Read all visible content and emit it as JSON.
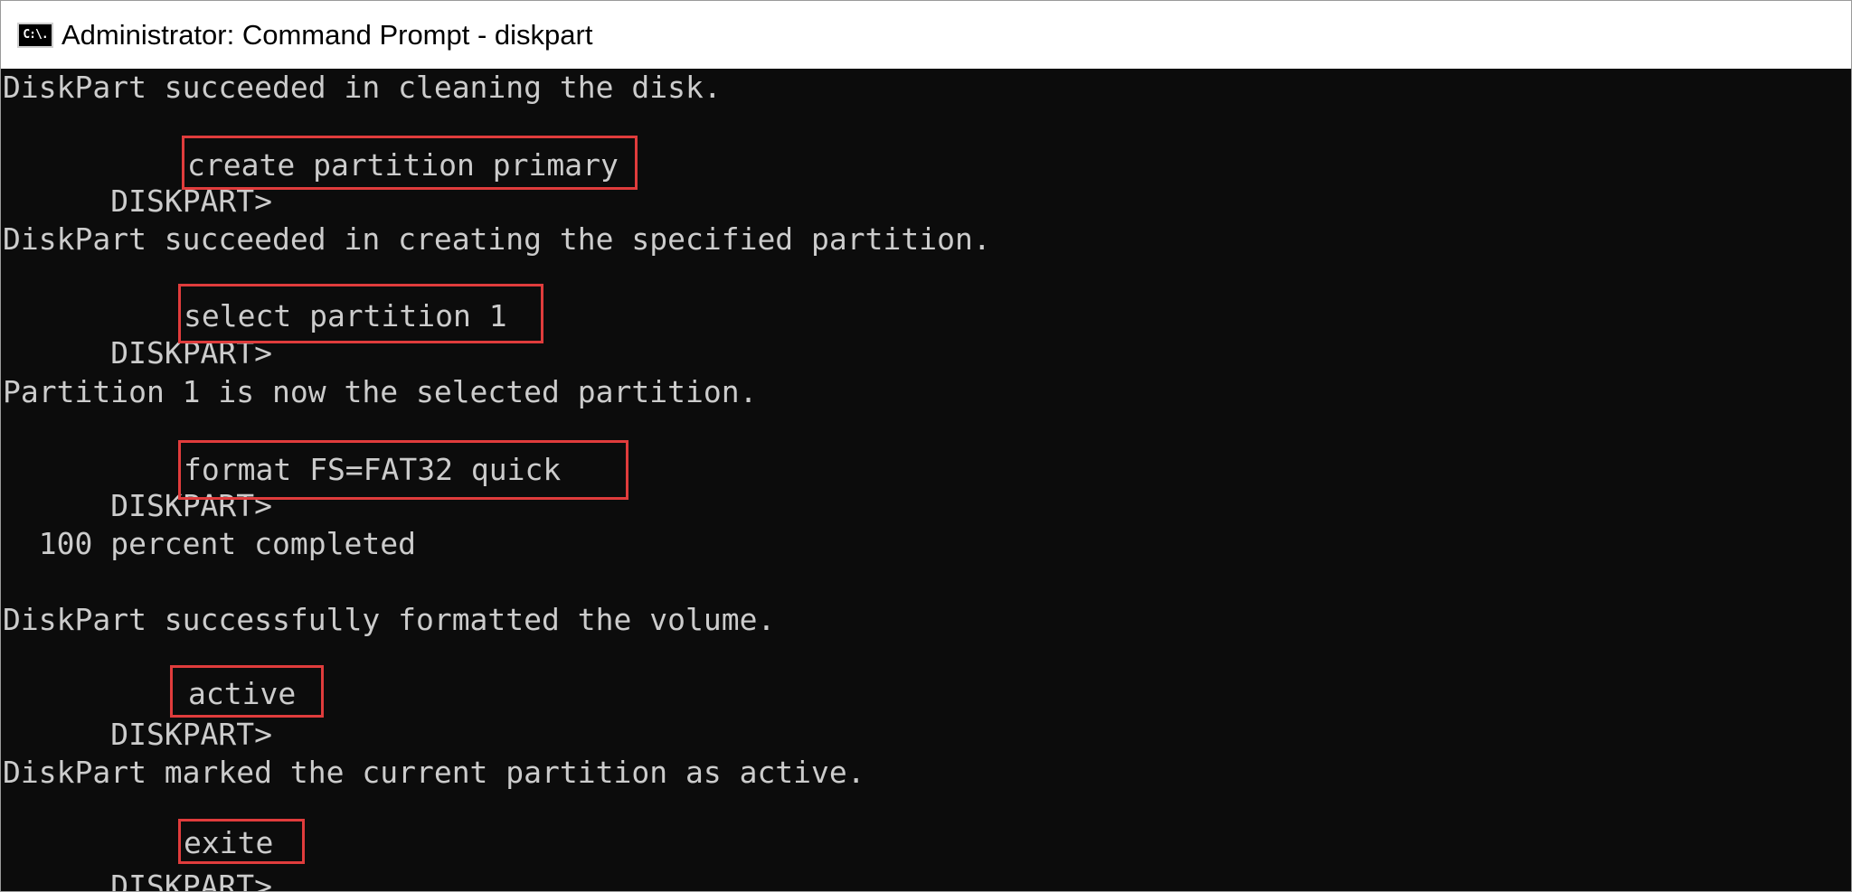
{
  "window": {
    "title": "Administrator: Command Prompt - diskpart",
    "icon": "command-prompt-icon",
    "icon_text": "C:\\."
  },
  "console": {
    "prompt": "DISKPART> ",
    "lines": [
      {
        "type": "output",
        "text": "DiskPart succeeded in cleaning the disk."
      },
      {
        "type": "command",
        "text": "create partition primary"
      },
      {
        "type": "output",
        "text": "DiskPart succeeded in creating the specified partition."
      },
      {
        "type": "command",
        "text": "select partition 1"
      },
      {
        "type": "output",
        "text": "Partition 1 is now the selected partition."
      },
      {
        "type": "command",
        "text": "format FS=FAT32 quick "
      },
      {
        "type": "output",
        "text": "  100 percent completed"
      },
      {
        "type": "output",
        "text": "DiskPart successfully formatted the volume."
      },
      {
        "type": "command",
        "text": "active "
      },
      {
        "type": "output",
        "text": "DiskPart marked the current partition as active."
      },
      {
        "type": "command",
        "text": "exite "
      }
    ]
  },
  "colors": {
    "background": "#0c0c0c",
    "text": "#cccccc",
    "highlight_box": "#e03c3c",
    "titlebar": "#ffffff"
  }
}
